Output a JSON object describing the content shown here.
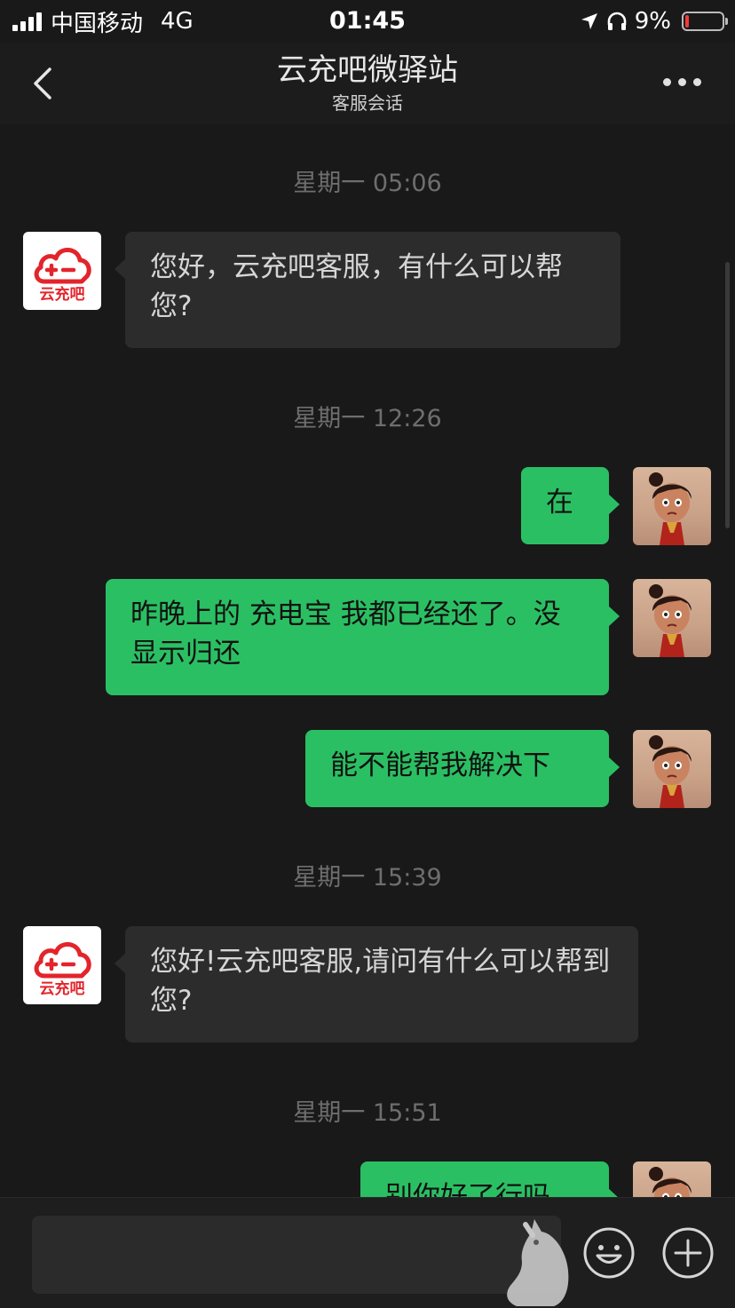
{
  "status_bar": {
    "carrier": "中国移动",
    "network": "4G",
    "time": "01:45",
    "battery_percent": "9%",
    "battery_level": 0.09,
    "colors": {
      "battery_low": "#f23b3b"
    }
  },
  "nav": {
    "title": "云充吧微驿站",
    "subtitle": "客服会话",
    "back_icon": "chevron-left-icon",
    "more_icon": "more-dots-icon"
  },
  "brand_avatar_text": "云充吧",
  "messages": [
    {
      "kind": "time",
      "text": "星期一 05:06"
    },
    {
      "kind": "incoming",
      "sender": "云充吧微驿站",
      "text": "您好，云充吧客服，有什么可以帮您?"
    },
    {
      "kind": "time",
      "text": "星期一 12:26"
    },
    {
      "kind": "outgoing",
      "text": "在"
    },
    {
      "kind": "outgoing",
      "text": "昨晚上的 充电宝 我都已经还了。没显示归还"
    },
    {
      "kind": "outgoing",
      "text": "能不能帮我解决下"
    },
    {
      "kind": "time",
      "text": "星期一 15:39"
    },
    {
      "kind": "incoming",
      "sender": "云充吧微驿站",
      "text": "您好!云充吧客服,请问有什么可以帮到您?"
    },
    {
      "kind": "time",
      "text": "星期一 15:51"
    },
    {
      "kind": "outgoing",
      "text": "别你好了行吗"
    }
  ],
  "input_bar": {
    "value": "",
    "emoji_icon": "emoji-icon",
    "plus_icon": "plus-icon"
  },
  "colors": {
    "background": "#191919",
    "incoming_bubble": "#2c2c2c",
    "outgoing_bubble": "#2bbf63",
    "timestamp": "#6e6e6e"
  }
}
